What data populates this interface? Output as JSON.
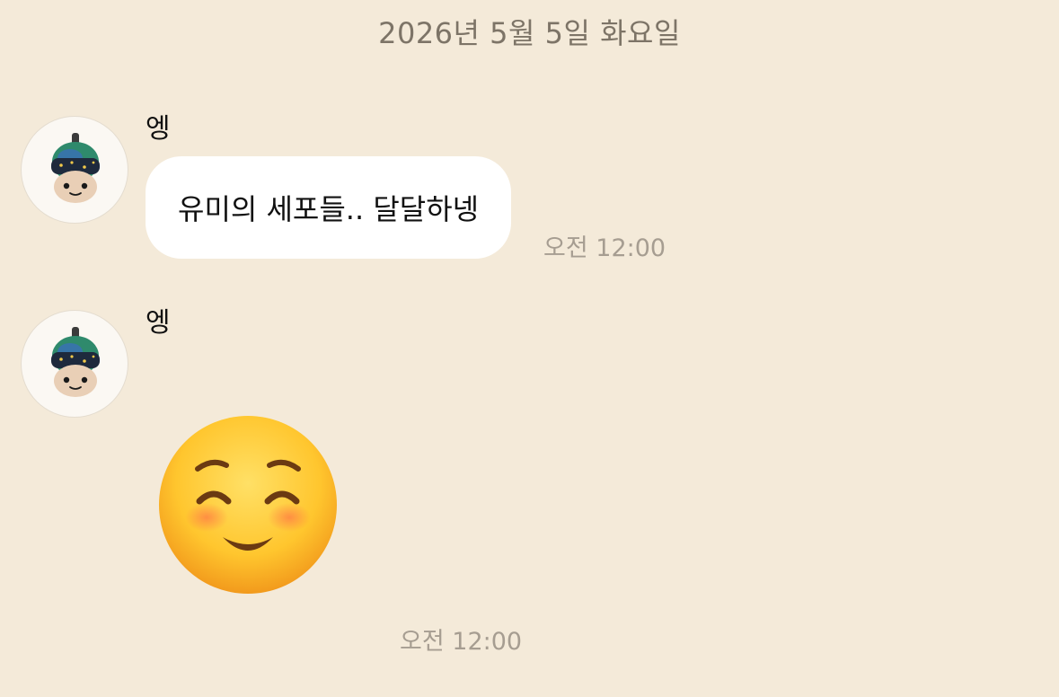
{
  "chat": {
    "date_header": "2026년 5월 5일 화요일",
    "messages": [
      {
        "sender": "엥",
        "type": "text",
        "text": "유미의 세포들.. 달달하넹",
        "time": "오전 12:00"
      },
      {
        "sender": "엥",
        "type": "emoji",
        "emoji_name": "smiling-face-with-closed-eyes-and-blush",
        "time": "오전 12:00"
      }
    ]
  },
  "colors": {
    "background": "#f4ead9",
    "bubble": "#ffffff",
    "timestamp": "#a69d91",
    "date_header": "#7d7467"
  },
  "icons": {
    "avatar": "character-doll-avatar",
    "sticker": "blushing-smile-emoji"
  }
}
